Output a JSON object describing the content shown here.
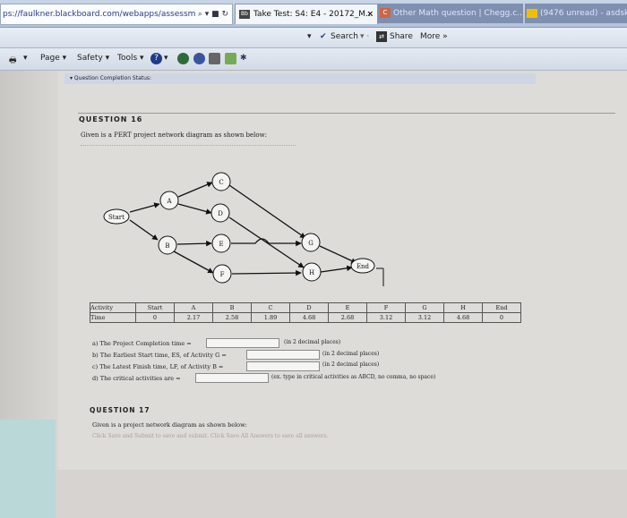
{
  "browser": {
    "address_url": "ps://faulkner.blackboard.com/webapps/assessm",
    "address_tools": "⌕ ▾ ■ ↻",
    "tabs": [
      {
        "label": "Take Test: S4: E4 - 20172_M...",
        "icon": "Bb"
      },
      {
        "label": "Other Math question | Chegg.c...",
        "icon": "C"
      },
      {
        "label": "(9476 unread) - asdsks...",
        "icon": ""
      }
    ],
    "command_bar": {
      "search": "Search",
      "share": "Share",
      "more": "More »"
    },
    "toolbar": {
      "page": "Page ▾",
      "safety": "Safety ▾",
      "tools": "Tools ▾"
    }
  },
  "status": {
    "label": "▾ Question Completion Status:"
  },
  "question16": {
    "title": "QUESTION 16",
    "text": "Given is a PERT project network diagram as shown below:",
    "nodes": [
      "Start",
      "A",
      "B",
      "C",
      "D",
      "E",
      "F",
      "G",
      "H",
      "End"
    ],
    "table": {
      "headers": [
        "Activity",
        "Start",
        "A",
        "B",
        "C",
        "D",
        "E",
        "F",
        "G",
        "H",
        "End"
      ],
      "row_label": "Time",
      "values": [
        "0",
        "2.17",
        "2.58",
        "1.89",
        "4.68",
        "2.68",
        "3.12",
        "3.12",
        "4.68",
        "0"
      ]
    },
    "answers": {
      "a": {
        "label": "a) The Project Completion time =",
        "hint": "(in 2 decimal places)",
        "value": ""
      },
      "b": {
        "label": "b) The Earliest Start time, ES, of Activity G =",
        "hint": "(in 2 decimal places)",
        "value": ""
      },
      "c": {
        "label": "c) The Latest Finish time, LF, of Activity B =",
        "hint": "(in 2 decimal places)",
        "value": ""
      },
      "d": {
        "label": "d) The critical activities are =",
        "hint": "(ex. type in critical activities as ABCD, no comma, no space)",
        "value": ""
      }
    }
  },
  "question17": {
    "title": "QUESTION 17",
    "text": "Given is a project network diagram as shown below:",
    "footer": "Click Save and Submit to save and submit. Click Save All Answers to save all answers."
  },
  "colors": {
    "tabbar": "#b9c8dc",
    "link": "#2a3c8a"
  }
}
